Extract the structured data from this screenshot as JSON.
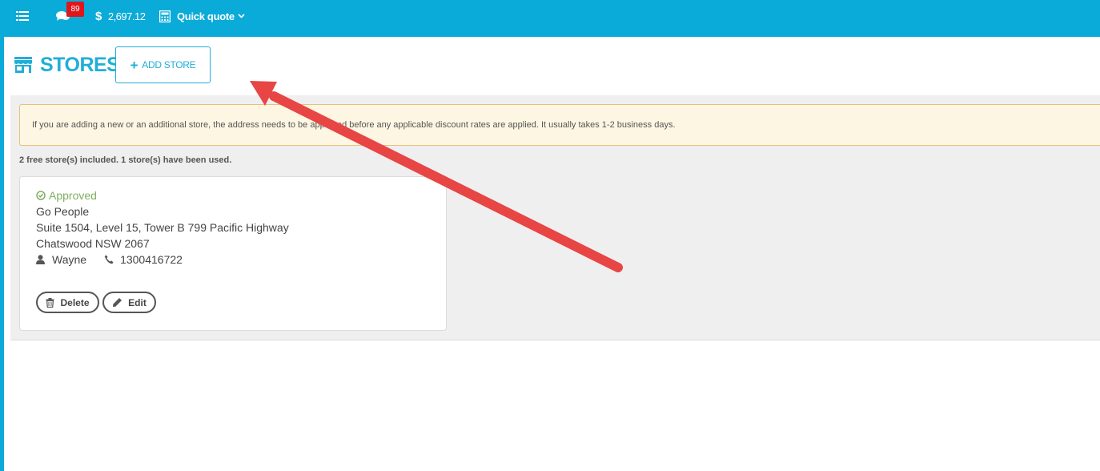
{
  "topbar": {
    "menu_icon": "menu-list-icon",
    "messages_icon": "chat-bubbles-icon",
    "messages_badge": "89",
    "balance_symbol": "$",
    "balance": "2,697.12",
    "quick_quote_label": "Quick quote",
    "quick_quote_icon": "calculator-icon",
    "accent_color": "#0aabd8",
    "badge_color": "#e0151b"
  },
  "page": {
    "title": "STORES",
    "title_icon": "storefront-icon",
    "add_store_label": "ADD STORE",
    "accent_color": "#21aed8"
  },
  "notice": {
    "text": "If you are adding a new or an additional store, the address needs to be approved before any applicable discount rates are applied. It usually takes 1-2 business days."
  },
  "usage_text": "2 free store(s) included. 1 store(s) have been used.",
  "stores": [
    {
      "status": "Approved",
      "status_color": "#7fae62",
      "name": "Go People",
      "address_line1": "Suite 1504, Level 15, Tower B 799 Pacific Highway",
      "address_line2": "Chatswood NSW 2067",
      "contact_name": "Wayne",
      "phone": "1300416722",
      "delete_label": "Delete",
      "edit_label": "Edit"
    }
  ],
  "annotation": {
    "arrow_color": "#e84545"
  }
}
